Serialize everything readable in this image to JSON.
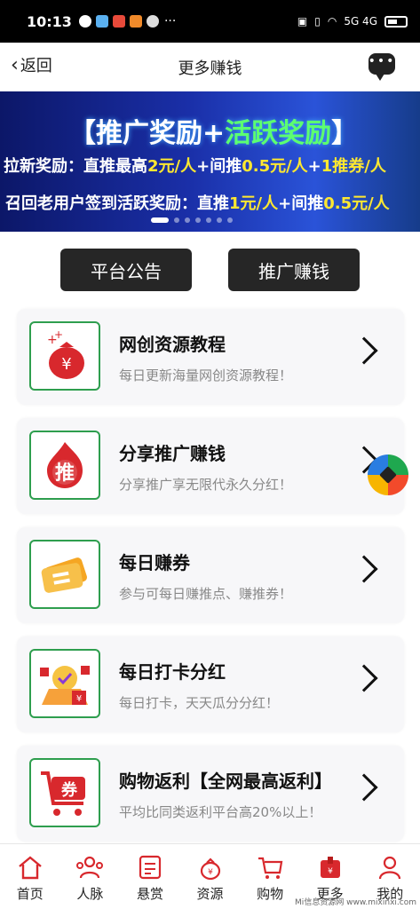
{
  "status_bar": {
    "time": "10:13",
    "more": "···",
    "network": "5G 4G"
  },
  "header": {
    "back_label": "返回",
    "title": "更多赚钱"
  },
  "banner": {
    "title_a": "【推广奖励+",
    "title_b": "活跃奖励",
    "title_c": "】",
    "line1": {
      "p1": "拉新奖励：直推最高",
      "v1": "2元/人",
      "p2": "+间推",
      "v2": "0.5元/人",
      "p3": "+",
      "v3": "1推券/人"
    },
    "line2": {
      "p1": "召回老用户签到活跃奖励：直推",
      "v1": "1元/人",
      "p2": "+间推",
      "v2": "0.5元/人"
    }
  },
  "tabs": {
    "announcement": "平台公告",
    "promote": "推广赚钱"
  },
  "cards": [
    {
      "title": "网创资源教程",
      "subtitle": "每日更新海量网创资源教程！",
      "icon": "money-bag-icon"
    },
    {
      "title": "分享推广赚钱",
      "subtitle": "分享推广享无限代永久分红！",
      "icon": "promote-flame-icon",
      "icon_text": "推"
    },
    {
      "title": "每日赚券",
      "subtitle": "参与可每日赚推点、赚推券！",
      "icon": "ticket-icon"
    },
    {
      "title": "每日打卡分红",
      "subtitle": "每日打卡，天天瓜分分红！",
      "icon": "checkin-gift-icon"
    },
    {
      "title": "购物返利【全网最高返利】",
      "subtitle": "平均比同类返利平台高20%以上！",
      "icon": "shopping-cart-icon",
      "icon_text": "券"
    }
  ],
  "bottom_nav": [
    {
      "label": "首页",
      "icon": "home-icon"
    },
    {
      "label": "人脉",
      "icon": "contacts-icon"
    },
    {
      "label": "悬赏",
      "icon": "task-list-icon"
    },
    {
      "label": "资源",
      "icon": "resource-bag-icon"
    },
    {
      "label": "购物",
      "icon": "shopping-icon"
    },
    {
      "label": "更多",
      "icon": "more-gift-icon"
    },
    {
      "label": "我的",
      "icon": "profile-icon"
    }
  ],
  "watermark": "Mi信息资源网 www.mixinxi.com",
  "colors": {
    "accent_red": "#d8282d",
    "icon_border_green": "#2e9e4e",
    "banner_blue": "#1a2fa8",
    "highlight_yellow": "#ffe830"
  }
}
